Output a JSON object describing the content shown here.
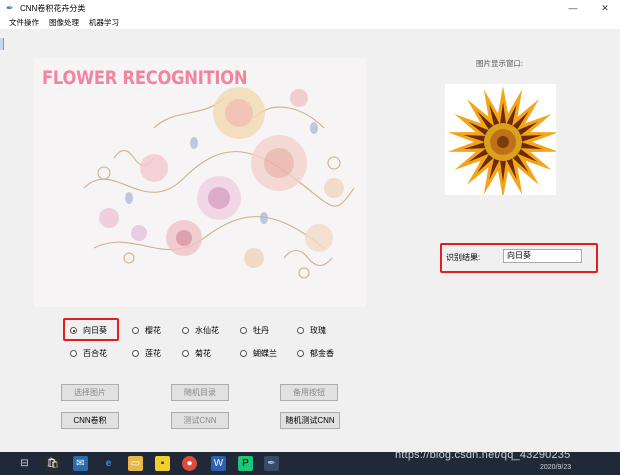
{
  "window": {
    "title": "CNN卷积花卉分类",
    "app_icon": "feather-icon",
    "minimize": "—",
    "close": "✕"
  },
  "menu": [
    "文件操作",
    "图像处理",
    "机器学习"
  ],
  "banner": {
    "heading": "FLOWER RECOGNITION"
  },
  "preview": {
    "label": "图片显示窗口:"
  },
  "result": {
    "label": "识别结果:",
    "value": "向日葵"
  },
  "radios": {
    "row1": [
      {
        "label": "向日葵",
        "checked": true
      },
      {
        "label": "樱花",
        "checked": false
      },
      {
        "label": "水仙花",
        "checked": false
      },
      {
        "label": "牡丹",
        "checked": false
      },
      {
        "label": "玫瑰",
        "checked": false
      }
    ],
    "row2": [
      {
        "label": "百合花",
        "checked": false
      },
      {
        "label": "莲花",
        "checked": false
      },
      {
        "label": "菊花",
        "checked": false
      },
      {
        "label": "蝴蝶兰",
        "checked": false
      },
      {
        "label": "郁金香",
        "checked": false
      }
    ]
  },
  "buttons": {
    "select_image": "选择图片",
    "random_dir": "随机目录",
    "spare": "备用按钮",
    "cnn_conv": "CNN卷积",
    "test_cnn": "测试CNN",
    "random_test_cnn": "随机测试CNN"
  },
  "taskbar": {
    "icons": [
      "task-view-icon",
      "store-icon",
      "mail-icon",
      "edge-icon",
      "folder-icon",
      "sticky-notes-icon",
      "chrome-icon",
      "word-icon",
      "pycharm-icon",
      "feather-app-icon"
    ],
    "date": "2020/9/23"
  },
  "watermark": "https://blog.csdn.net/qq_43290235",
  "colors": {
    "accent_red": "#e02020",
    "heading_pink": "#f1849e",
    "taskbar": "#1f2937"
  }
}
